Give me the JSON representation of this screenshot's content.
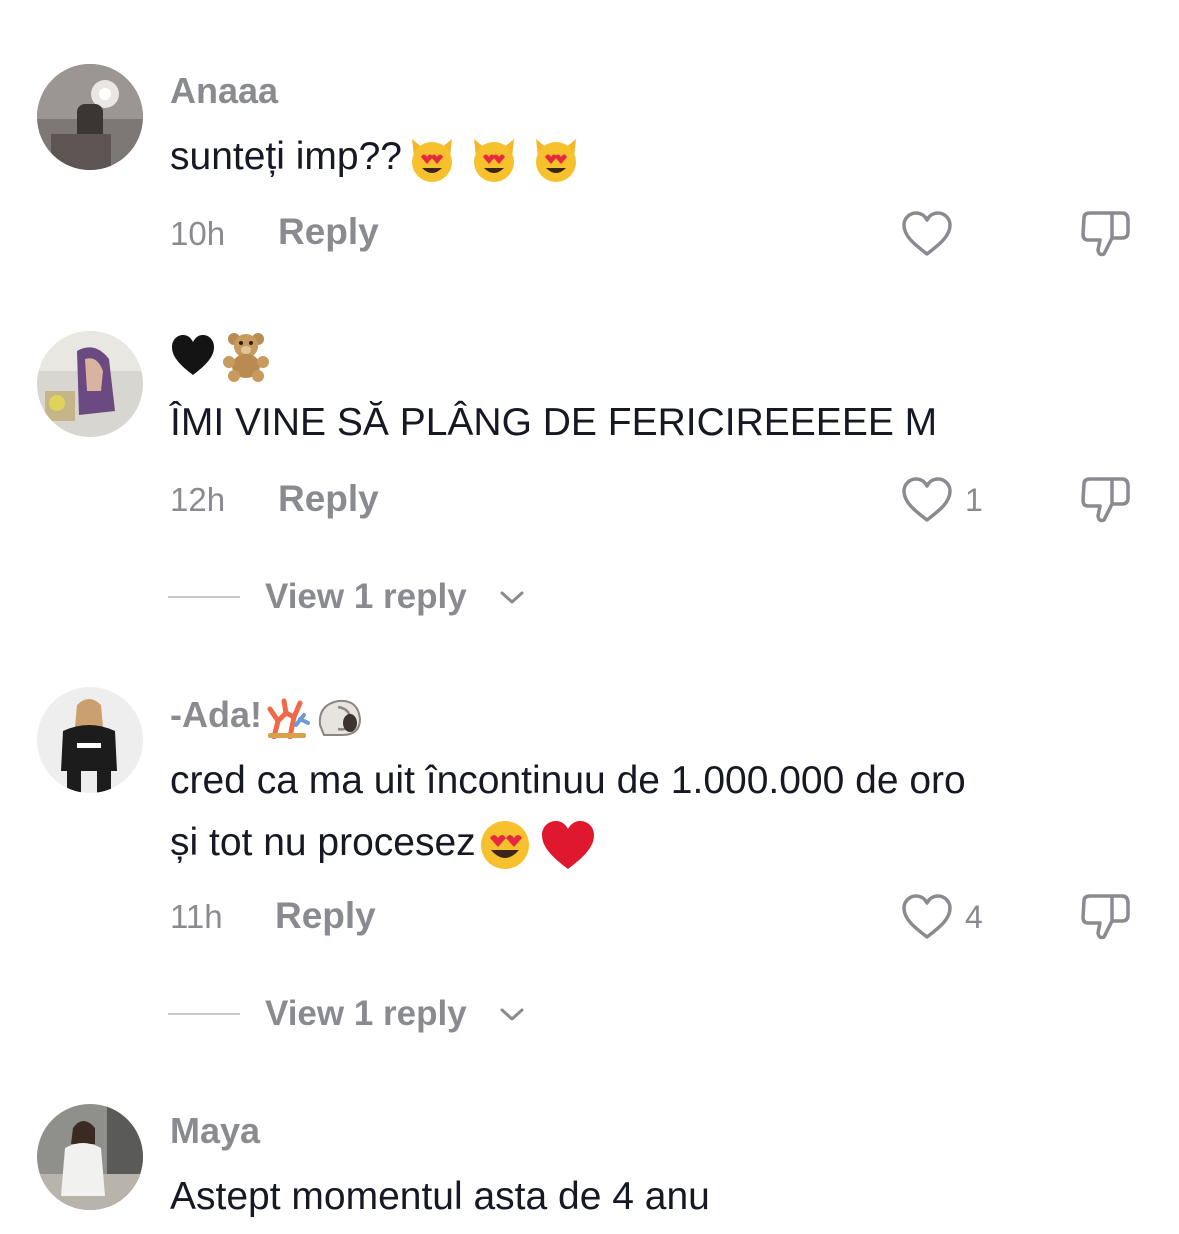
{
  "comments": [
    {
      "username": "Anaaa",
      "text": "sunteți imp??",
      "text_emojis": [
        "heart-eyes-cat",
        "heart-eyes-cat",
        "heart-eyes-cat"
      ],
      "time": "10h",
      "reply_label": "Reply",
      "likes": ""
    },
    {
      "username_emojis": [
        "black-heart",
        "teddy-bear"
      ],
      "text": "ÎMI VINE SĂ PLÂNG DE FERICIREEEEE M",
      "time": "12h",
      "reply_label": "Reply",
      "likes": "1",
      "view_replies": "View 1 reply"
    },
    {
      "username": "-Ada!",
      "username_emojis": [
        "coral",
        "spiral-shell"
      ],
      "text_line1": "cred ca ma uit încontinuu de 1.000.000 de oro",
      "text_line2": "și tot nu procesez",
      "text_emojis": [
        "heart-eyes",
        "red-heart"
      ],
      "time": "11h",
      "reply_label": "Reply",
      "likes": "4",
      "view_replies": "View 1 reply"
    },
    {
      "username": "Maya",
      "text": "Astept momentul asta de 4 anu"
    }
  ],
  "colors": {
    "primary_text": "#161823",
    "secondary_text": "#8a8b91",
    "icon": "#8a8b91"
  }
}
